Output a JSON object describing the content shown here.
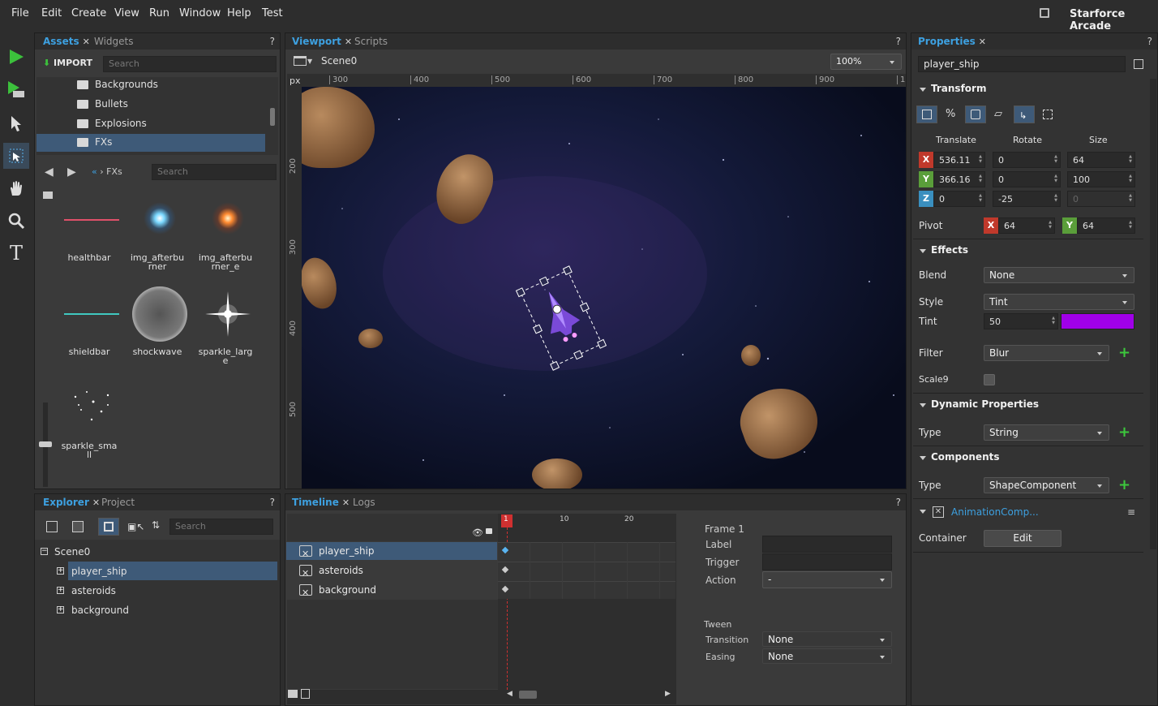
{
  "menu": [
    "File",
    "Edit",
    "Create",
    "View",
    "Run",
    "Window",
    "Help",
    "Test"
  ],
  "app_title": "Starforce Arcade",
  "assets": {
    "tabs": [
      "Assets",
      "Widgets"
    ],
    "import_label": "IMPORT",
    "search_placeholder": "Search",
    "folders": [
      "Backgrounds",
      "Bullets",
      "Explosions",
      "FXs"
    ],
    "breadcrumb": "FXs",
    "nav_search_placeholder": "Search",
    "items": [
      "healthbar",
      "img_afterbu\nrner",
      "img_afterbu\nrner_e",
      "shieldbar",
      "shockwave",
      "sparkle_larg\ne",
      "sparkle_sma\nll"
    ]
  },
  "viewport": {
    "tabs": [
      "Viewport",
      "Scripts"
    ],
    "scene": "Scene0",
    "zoom": "100%",
    "ruler_unit": "px",
    "ruler_x": [
      "300",
      "400",
      "500",
      "600",
      "700",
      "800",
      "900",
      "1"
    ],
    "ruler_y": [
      "200",
      "300",
      "400",
      "500"
    ]
  },
  "properties": {
    "tab": "Properties",
    "object_name": "player_ship",
    "transform": {
      "title": "Transform",
      "headers": [
        "Translate",
        "Rotate",
        "Size"
      ],
      "x": [
        "536.11",
        "0",
        "64"
      ],
      "y": [
        "366.16",
        "0",
        "100"
      ],
      "z": [
        "0",
        "-25",
        "0"
      ],
      "pivot_label": "Pivot",
      "pivot_x": "64",
      "pivot_y": "64"
    },
    "effects": {
      "title": "Effects",
      "blend_label": "Blend",
      "blend": "None",
      "style_label": "Style",
      "style": "Tint",
      "tint_label": "Tint",
      "tint_value": "50",
      "tint_color": "#a000e8",
      "filter_label": "Filter",
      "filter": "Blur",
      "scale9_label": "Scale9"
    },
    "dynamic": {
      "title": "Dynamic Properties",
      "type_label": "Type",
      "type": "String"
    },
    "components": {
      "title": "Components",
      "type_label": "Type",
      "type": "ShapeComponent"
    },
    "animation": {
      "title": "AnimationComp...",
      "container_label": "Container",
      "edit_label": "Edit"
    }
  },
  "explorer": {
    "tabs": [
      "Explorer",
      "Project"
    ],
    "search_placeholder": "Search",
    "root": "Scene0",
    "children": [
      "player_ship",
      "asteroids",
      "background"
    ]
  },
  "timeline": {
    "tabs": [
      "Timeline",
      "Logs"
    ],
    "rows": [
      "player_ship",
      "asteroids",
      "background"
    ],
    "frame_marks": [
      "1",
      "10",
      "20"
    ],
    "frame_title": "Frame 1",
    "label_label": "Label",
    "trigger_label": "Trigger",
    "action_label": "Action",
    "action_value": "-",
    "tween_title": "Tween",
    "transition_label": "Transition",
    "transition_value": "None",
    "easing_label": "Easing",
    "easing_value": "None"
  },
  "colors": {
    "accent": "#3da0e0",
    "axis_x": "#c0392b",
    "axis_y": "#5a9e3a",
    "axis_z": "#3a8fbf",
    "plus": "#3cc83c"
  }
}
